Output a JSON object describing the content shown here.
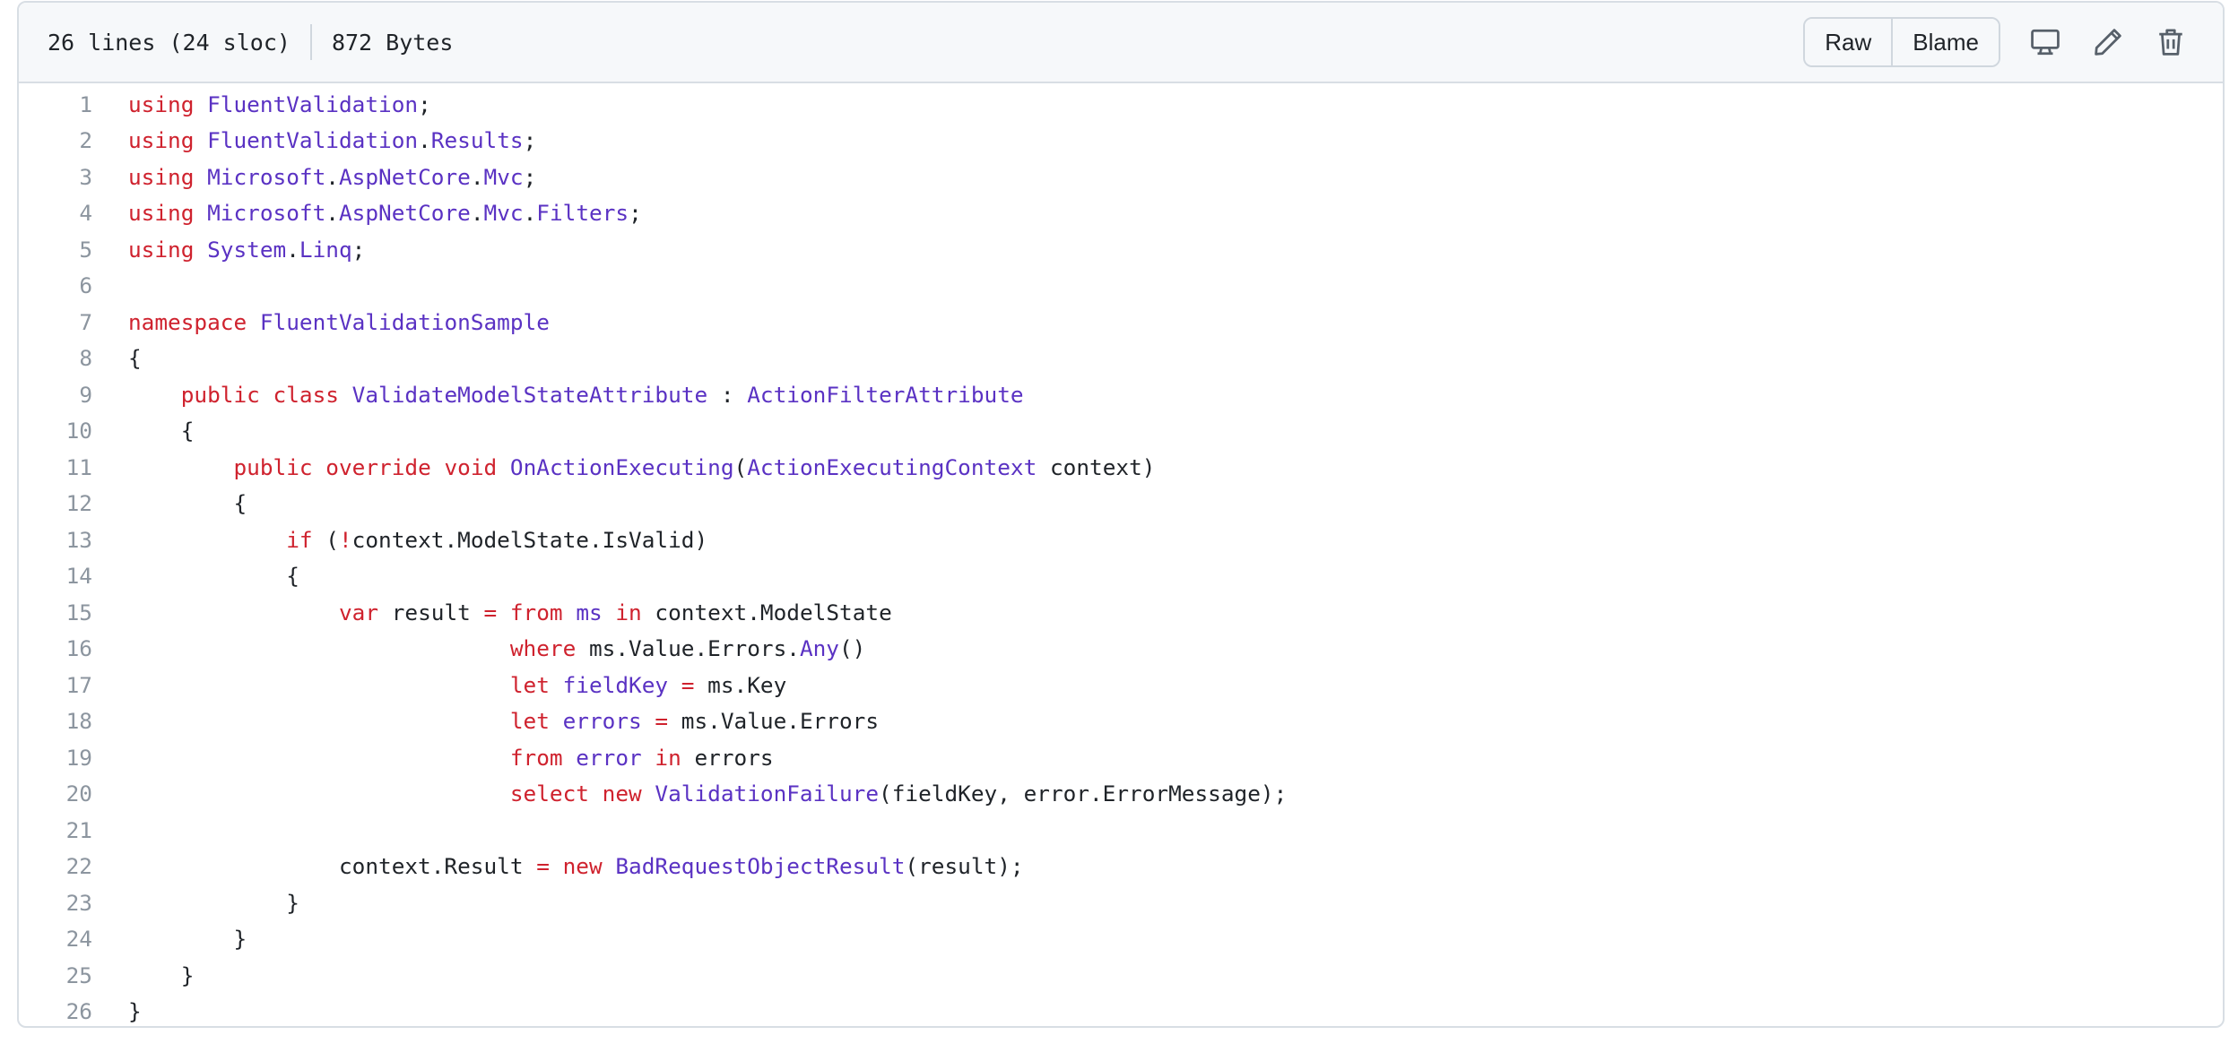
{
  "file_header": {
    "lines_info": "26 lines (24 sloc)",
    "size": "872 Bytes",
    "raw_label": "Raw",
    "blame_label": "Blame",
    "icons": [
      "desktop-icon",
      "pencil-icon",
      "trash-icon"
    ]
  },
  "colors": {
    "keyword": "#cf222e",
    "type": "#5a32c3",
    "plain": "#1f2328",
    "line_number": "#8c959f"
  },
  "code_lines": [
    [
      [
        "k",
        "using"
      ],
      [
        "p",
        " "
      ],
      [
        "t",
        "FluentValidation"
      ],
      [
        "p",
        ";"
      ]
    ],
    [
      [
        "k",
        "using"
      ],
      [
        "p",
        " "
      ],
      [
        "t",
        "FluentValidation"
      ],
      [
        "p",
        "."
      ],
      [
        "t",
        "Results"
      ],
      [
        "p",
        ";"
      ]
    ],
    [
      [
        "k",
        "using"
      ],
      [
        "p",
        " "
      ],
      [
        "t",
        "Microsoft"
      ],
      [
        "p",
        "."
      ],
      [
        "t",
        "AspNetCore"
      ],
      [
        "p",
        "."
      ],
      [
        "t",
        "Mvc"
      ],
      [
        "p",
        ";"
      ]
    ],
    [
      [
        "k",
        "using"
      ],
      [
        "p",
        " "
      ],
      [
        "t",
        "Microsoft"
      ],
      [
        "p",
        "."
      ],
      [
        "t",
        "AspNetCore"
      ],
      [
        "p",
        "."
      ],
      [
        "t",
        "Mvc"
      ],
      [
        "p",
        "."
      ],
      [
        "t",
        "Filters"
      ],
      [
        "p",
        ";"
      ]
    ],
    [
      [
        "k",
        "using"
      ],
      [
        "p",
        " "
      ],
      [
        "t",
        "System"
      ],
      [
        "p",
        "."
      ],
      [
        "t",
        "Linq"
      ],
      [
        "p",
        ";"
      ]
    ],
    [],
    [
      [
        "k",
        "namespace"
      ],
      [
        "p",
        " "
      ],
      [
        "t",
        "FluentValidationSample"
      ]
    ],
    [
      [
        "p",
        "{"
      ]
    ],
    [
      [
        "p",
        "    "
      ],
      [
        "k",
        "public"
      ],
      [
        "p",
        " "
      ],
      [
        "k",
        "class"
      ],
      [
        "p",
        " "
      ],
      [
        "t",
        "ValidateModelStateAttribute"
      ],
      [
        "p",
        " : "
      ],
      [
        "t",
        "ActionFilterAttribute"
      ]
    ],
    [
      [
        "p",
        "    {"
      ]
    ],
    [
      [
        "p",
        "        "
      ],
      [
        "k",
        "public"
      ],
      [
        "p",
        " "
      ],
      [
        "k",
        "override"
      ],
      [
        "p",
        " "
      ],
      [
        "k",
        "void"
      ],
      [
        "p",
        " "
      ],
      [
        "t",
        "OnActionExecuting"
      ],
      [
        "p",
        "("
      ],
      [
        "t",
        "ActionExecutingContext"
      ],
      [
        "p",
        " context)"
      ]
    ],
    [
      [
        "p",
        "        {"
      ]
    ],
    [
      [
        "p",
        "            "
      ],
      [
        "k",
        "if"
      ],
      [
        "p",
        " ("
      ],
      [
        "k",
        "!"
      ],
      [
        "p",
        "context.ModelState.IsValid)"
      ]
    ],
    [
      [
        "p",
        "            {"
      ]
    ],
    [
      [
        "p",
        "                "
      ],
      [
        "k",
        "var"
      ],
      [
        "p",
        " result "
      ],
      [
        "k",
        "="
      ],
      [
        "p",
        " "
      ],
      [
        "k",
        "from"
      ],
      [
        "p",
        " "
      ],
      [
        "t",
        "ms"
      ],
      [
        "p",
        " "
      ],
      [
        "k",
        "in"
      ],
      [
        "p",
        " context.ModelState"
      ]
    ],
    [
      [
        "p",
        "                             "
      ],
      [
        "k",
        "where"
      ],
      [
        "p",
        " ms.Value.Errors."
      ],
      [
        "t",
        "Any"
      ],
      [
        "p",
        "()"
      ]
    ],
    [
      [
        "p",
        "                             "
      ],
      [
        "k",
        "let"
      ],
      [
        "p",
        " "
      ],
      [
        "t",
        "fieldKey"
      ],
      [
        "p",
        " "
      ],
      [
        "k",
        "="
      ],
      [
        "p",
        " ms.Key"
      ]
    ],
    [
      [
        "p",
        "                             "
      ],
      [
        "k",
        "let"
      ],
      [
        "p",
        " "
      ],
      [
        "t",
        "errors"
      ],
      [
        "p",
        " "
      ],
      [
        "k",
        "="
      ],
      [
        "p",
        " ms.Value.Errors"
      ]
    ],
    [
      [
        "p",
        "                             "
      ],
      [
        "k",
        "from"
      ],
      [
        "p",
        " "
      ],
      [
        "t",
        "error"
      ],
      [
        "p",
        " "
      ],
      [
        "k",
        "in"
      ],
      [
        "p",
        " errors"
      ]
    ],
    [
      [
        "p",
        "                             "
      ],
      [
        "k",
        "select"
      ],
      [
        "p",
        " "
      ],
      [
        "k",
        "new"
      ],
      [
        "p",
        " "
      ],
      [
        "t",
        "ValidationFailure"
      ],
      [
        "p",
        "(fieldKey, error.ErrorMessage);"
      ]
    ],
    [],
    [
      [
        "p",
        "                context.Result "
      ],
      [
        "k",
        "="
      ],
      [
        "p",
        " "
      ],
      [
        "k",
        "new"
      ],
      [
        "p",
        " "
      ],
      [
        "t",
        "BadRequestObjectResult"
      ],
      [
        "p",
        "(result);"
      ]
    ],
    [
      [
        "p",
        "            }"
      ]
    ],
    [
      [
        "p",
        "        }"
      ]
    ],
    [
      [
        "p",
        "    }"
      ]
    ],
    [
      [
        "p",
        "}"
      ]
    ]
  ]
}
